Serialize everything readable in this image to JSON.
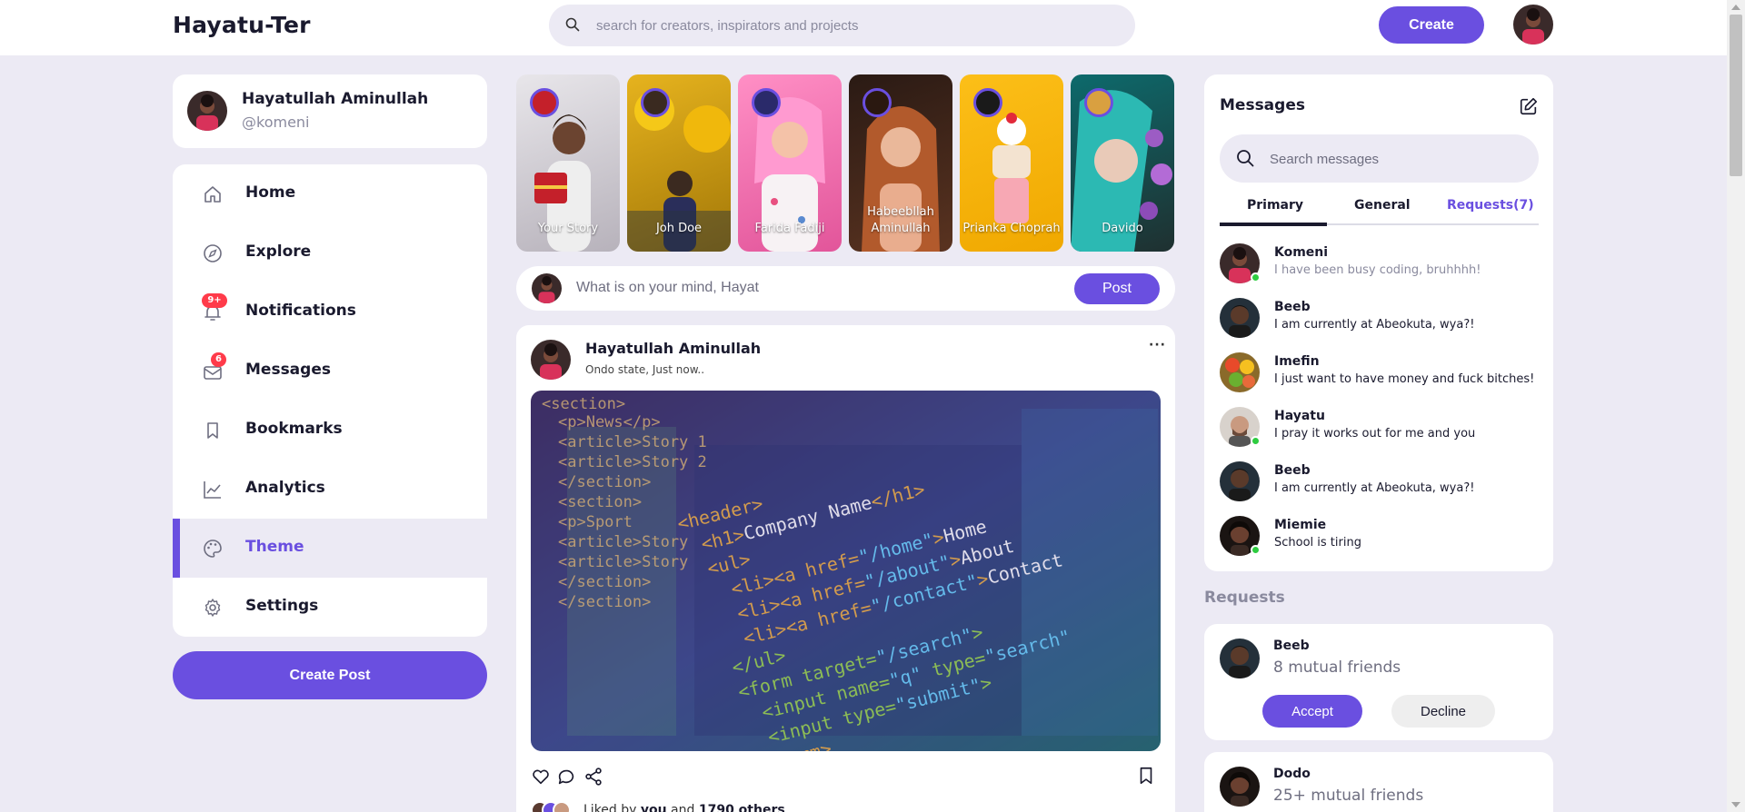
{
  "app": {
    "logo": "Hayatu-Ter",
    "search_placeholder": "search for creators, inspirators and projects",
    "create_label": "Create"
  },
  "profile": {
    "name": "Hayatullah Aminullah",
    "handle": "@komeni"
  },
  "sidebar": {
    "items": [
      {
        "label": "Home",
        "icon": "home-icon"
      },
      {
        "label": "Explore",
        "icon": "compass-icon"
      },
      {
        "label": "Notifications",
        "icon": "bell-icon",
        "badge": "9+"
      },
      {
        "label": "Messages",
        "icon": "envelope-icon",
        "badge": "6"
      },
      {
        "label": "Bookmarks",
        "icon": "bookmark-icon"
      },
      {
        "label": "Analytics",
        "icon": "chart-line-icon"
      },
      {
        "label": "Theme",
        "icon": "palette-icon",
        "active": true
      },
      {
        "label": "Settings",
        "icon": "gear-icon"
      }
    ],
    "create_post_label": "Create Post"
  },
  "stories": [
    {
      "name": "Your Story",
      "color": "#d8d4dc"
    },
    {
      "name": "Joh Doe",
      "color": "#d6a216"
    },
    {
      "name": "Farida Fadiji",
      "color": "#f07ab5"
    },
    {
      "name": "Habeebllah Aminullah",
      "color": "#6a3a24"
    },
    {
      "name": "Prianka Choprah",
      "color": "#f5b20f"
    },
    {
      "name": "Davido",
      "color": "#2fa6a4"
    }
  ],
  "composer": {
    "placeholder": "What is on your mind, Hayat",
    "post_label": "Post"
  },
  "feed": {
    "author": "Hayatullah Aminullah",
    "meta": "Ondo state, Just now..",
    "more": "···",
    "liked_by_prefix": "Liked by ",
    "liked_by_you": "you",
    "liked_by_and": " and ",
    "liked_by_others": "1790 others",
    "liked_by_suffix": ".."
  },
  "messages": {
    "title": "Messages",
    "search_placeholder": "Search messages",
    "tabs": [
      "Primary",
      "General",
      "Requests(7)"
    ],
    "list": [
      {
        "name": "Komeni",
        "text": "I have been busy coding, bruhhhh!",
        "online": true,
        "muted": true
      },
      {
        "name": "Beeb",
        "text": "I am currently at Abeokuta, wya?!",
        "online": false
      },
      {
        "name": "Imefin",
        "text": "I just want to have money and fuck bitches!",
        "online": false
      },
      {
        "name": "Hayatu",
        "text": "I pray it works out for me and you",
        "online": true
      },
      {
        "name": "Beeb",
        "text": "I am currently at Abeokuta, wya?!",
        "online": false
      },
      {
        "name": "Miemie",
        "text": "School is tiring",
        "online": true
      }
    ]
  },
  "requests": {
    "heading": "Requests",
    "items": [
      {
        "name": "Beeb",
        "mutual": "8 mutual friends",
        "accept": "Accept",
        "decline": "Decline"
      },
      {
        "name": "Dodo",
        "mutual": "25+ mutual friends"
      }
    ]
  },
  "colors": {
    "accent": "#6a4fe0",
    "background": "#eceaf4",
    "badge": "#ff3b4a",
    "online": "#2ecc40"
  }
}
